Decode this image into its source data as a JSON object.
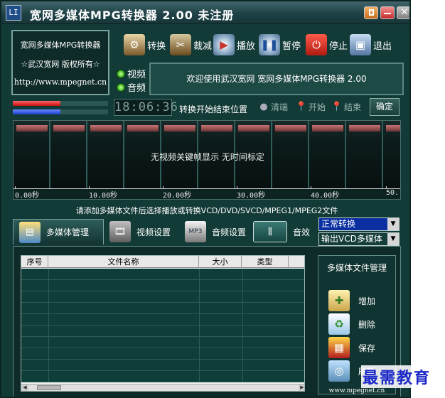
{
  "window": {
    "title": "宽网多媒体MPG转换器 2.00 未注册",
    "icon_text": "LI"
  },
  "about": {
    "name": "宽网多媒体MPG转换器",
    "copyright": "☆武汉宽网 版权所有☆",
    "url": "http://www.mpegnet.cn"
  },
  "toolbar": {
    "convert": "转换",
    "cut": "裁减",
    "play": "播放",
    "pause": "暂停",
    "stop": "停止",
    "exit": "退出"
  },
  "toggles": {
    "video": "视频",
    "audio": "音频"
  },
  "status_message": "欢迎使用武汉宽网 宽网多媒体MPG转换器 2.00",
  "meters": {
    "red_level": 0.5,
    "blue_level": 0.5
  },
  "time_display": "18:06:36",
  "range": {
    "label": "转换开始结束位置",
    "clear": "清端",
    "start": "开始",
    "end": "结束",
    "confirm": "确定"
  },
  "filmstrip": {
    "empty_text": "无视频关键帧显示 无时间标定",
    "ticks": [
      "0.00秒",
      "10.00秒",
      "20.00秒",
      "30.00秒",
      "40.00秒",
      "50."
    ]
  },
  "hint": "请添加多媒体文件后选择播放或转换VCD/DVD/SVCD/MPEG1/MPEG2文件",
  "tabs": {
    "media": "多媒体管理",
    "video": "视频设置",
    "audio": "音频设置",
    "audio_icon_text": "MP3",
    "effects": "音效"
  },
  "mode_select": "正常转换",
  "output_select": "输出VCD多媒体",
  "file_table": {
    "columns": [
      "序号",
      "文件名称",
      "大小",
      "类型",
      ""
    ],
    "row_count": 10
  },
  "manager": {
    "title": "多媒体文件管理",
    "add": "增加",
    "delete": "删除",
    "save": "保存",
    "refresh": "刷新",
    "url": "www.mpegnet.cn"
  },
  "watermark": "最需教育",
  "colors": {
    "background": "#123a36",
    "accent_select": "#0a2fa0",
    "banner": "#1e4a46"
  }
}
